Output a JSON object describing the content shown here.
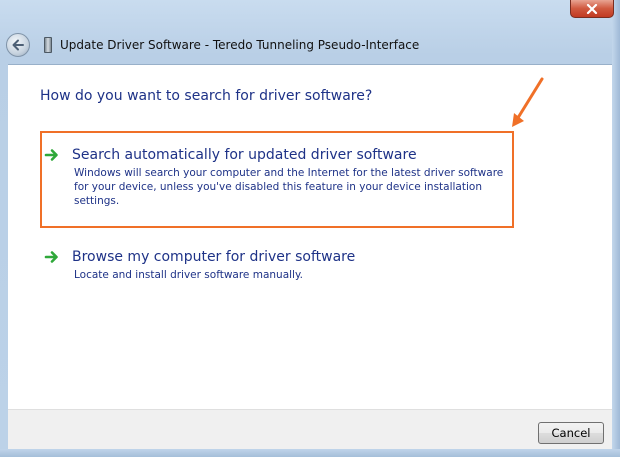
{
  "window": {
    "title": "Update Driver Software - Teredo Tunneling Pseudo-Interface",
    "close_label": "x",
    "frame_color": "#bcd2e8"
  },
  "dialog": {
    "heading": "How do you want to search for driver software?",
    "options": [
      {
        "icon": "green-arrow-icon",
        "title": "Search automatically for updated driver software",
        "description": "Windows will search your computer and the Internet for the latest driver software for your device, unless you've disabled this feature in your device installation settings.",
        "highlighted": true
      },
      {
        "icon": "green-arrow-icon",
        "title": "Browse my computer for driver software",
        "description": "Locate and install driver software manually.",
        "highlighted": false
      }
    ],
    "text_color": "#1e3287",
    "highlight_color": "#f07028"
  },
  "footer": {
    "cancel_label": "Cancel"
  }
}
